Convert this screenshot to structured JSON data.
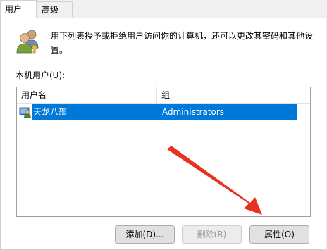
{
  "tabs": [
    {
      "label": "用户",
      "active": true
    },
    {
      "label": "高级",
      "active": false
    }
  ],
  "intro_text": "用下列表授予或拒绝用户访问你的计算机，还可以更改其密码和其他设置。",
  "list_label": "本机用户(U):",
  "columns": [
    "用户名",
    "组"
  ],
  "rows": [
    {
      "username": "天龙八部",
      "group": "Administrators",
      "selected": true
    }
  ],
  "buttons": {
    "add": "添加(D)...",
    "delete": "删除(R)",
    "properties": "属性(O)"
  },
  "colors": {
    "selection": "#0078d7",
    "annotation_arrow": "#e8321f"
  },
  "icons": {
    "users": "users-icon",
    "user_row": "user-icon",
    "annotation": "red-arrow"
  }
}
